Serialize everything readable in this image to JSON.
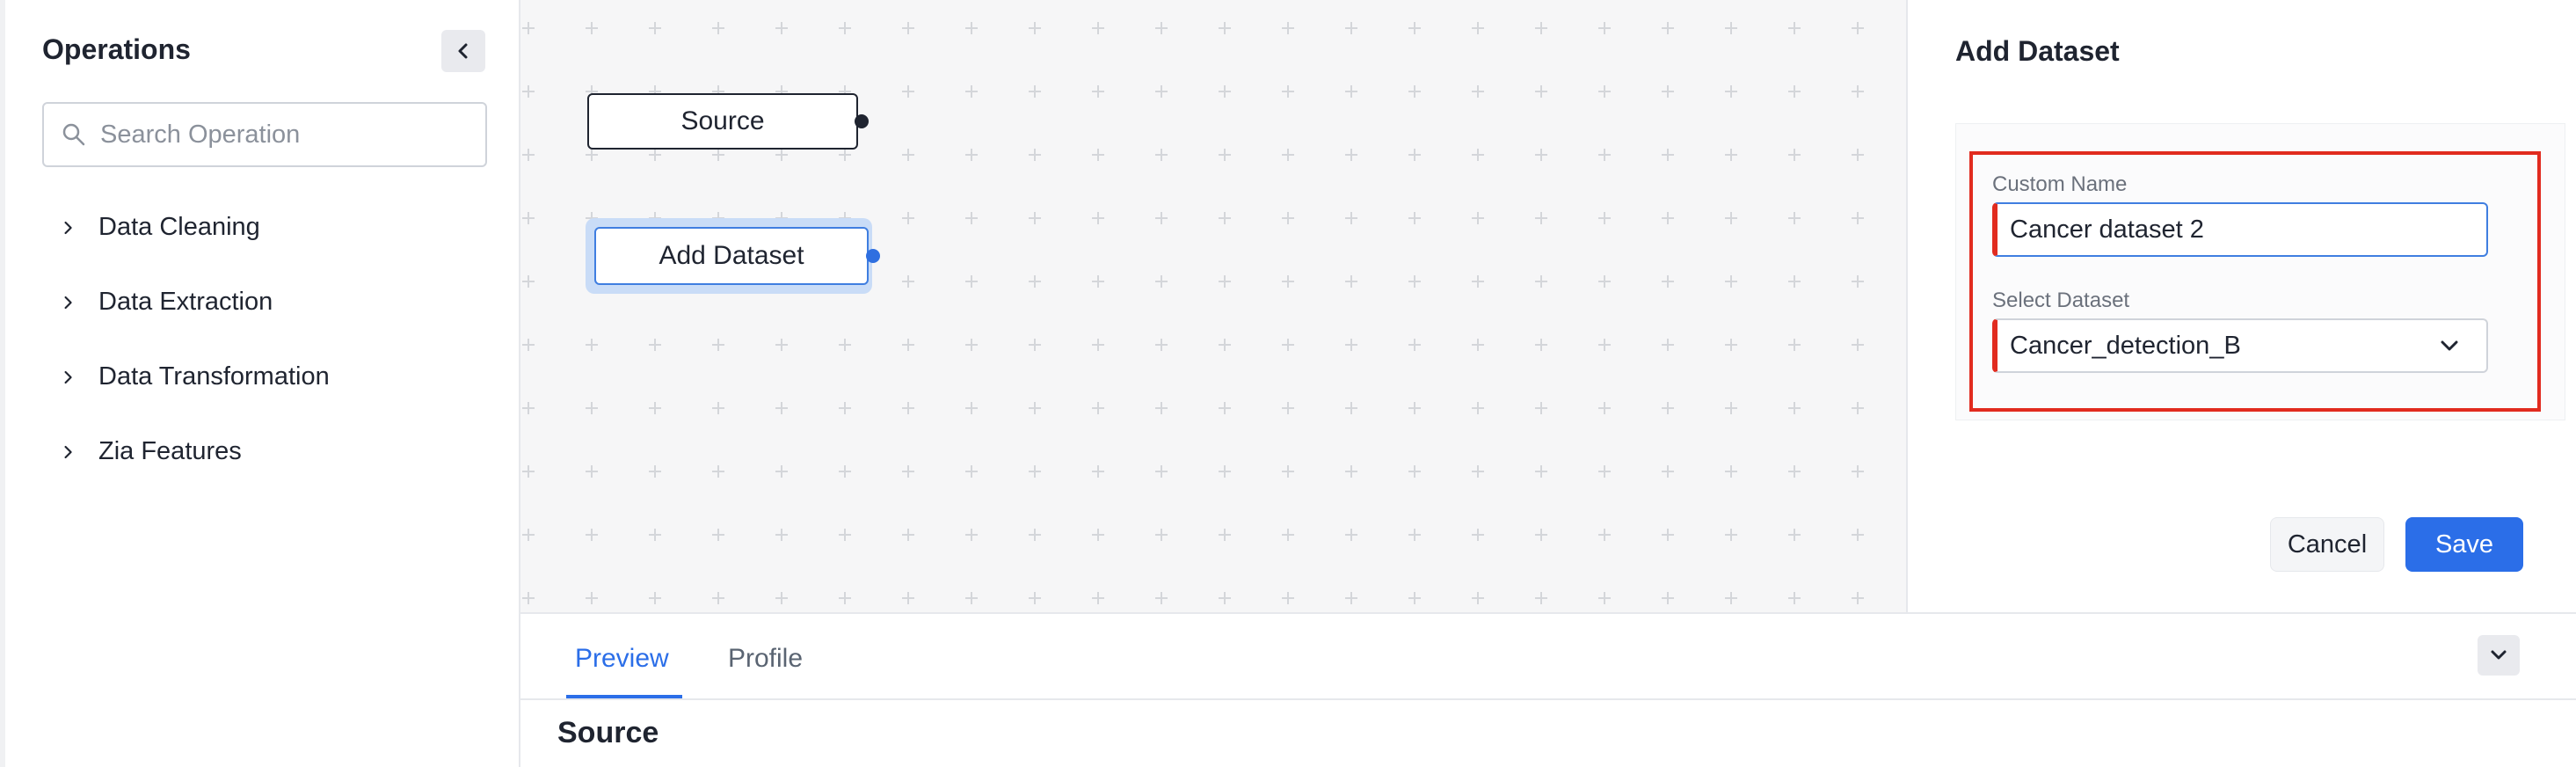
{
  "sidebar": {
    "title": "Operations",
    "search": {
      "placeholder": "Search Operation",
      "value": ""
    },
    "items": [
      {
        "label": "Data Cleaning"
      },
      {
        "label": "Data Extraction"
      },
      {
        "label": "Data Transformation"
      },
      {
        "label": "Zia Features"
      }
    ]
  },
  "canvas": {
    "nodes": [
      {
        "label": "Source"
      },
      {
        "label": "Add Dataset"
      }
    ]
  },
  "panel": {
    "title": "Add Dataset",
    "custom_name_label": "Custom Name",
    "custom_name_value": "Cancer dataset 2",
    "select_dataset_label": "Select Dataset",
    "select_dataset_value": "Cancer_detection_B",
    "cancel_label": "Cancel",
    "save_label": "Save"
  },
  "bottom": {
    "tabs": [
      {
        "label": "Preview",
        "active": true
      },
      {
        "label": "Profile",
        "active": false
      }
    ],
    "section_title": "Source"
  },
  "colors": {
    "accent": "#2b6ee8",
    "highlight": "#e12b1f",
    "canvas_bg": "#f6f6f7"
  }
}
